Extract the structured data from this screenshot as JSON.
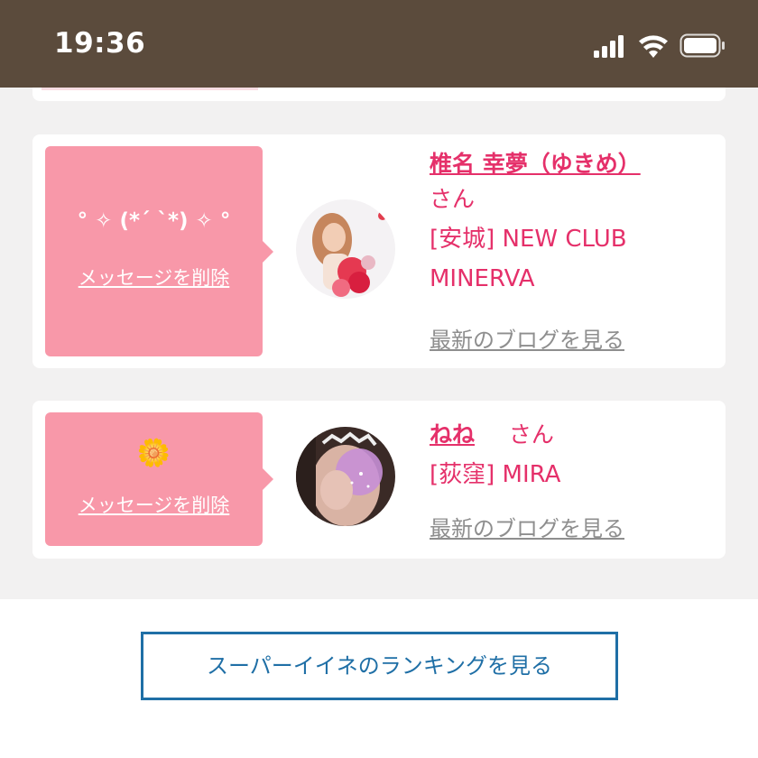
{
  "status_bar": {
    "time": "19:36",
    "signal_icon": "cellular-signal-icon",
    "wifi_icon": "wifi-icon",
    "battery_icon": "battery-icon"
  },
  "colors": {
    "status_bar_bg": "#5b4b3c",
    "content_bg": "#f2f1f1",
    "bubble": "#f898a9",
    "accent_pink": "#e5306a",
    "link_gray": "#8e8e8e",
    "button_blue": "#1f6fa6"
  },
  "cards": [
    {
      "message": "° ✧ (*´ `*) ✧ °",
      "delete_label": "メッセージを削除",
      "name": "椎名 幸夢（ゆきめ）",
      "honorific": "さん",
      "shop": "[安城] NEW CLUB MINERVA",
      "blog_label": "最新のブログを見る"
    },
    {
      "message": "🌼",
      "delete_label": "メッセージを削除",
      "name": "ねね",
      "honorific": "さん",
      "shop": "[荻窪] MIRA",
      "blog_label": "最新のブログを見る"
    }
  ],
  "ranking_button": {
    "label": "スーパーイイネのランキングを見る"
  }
}
